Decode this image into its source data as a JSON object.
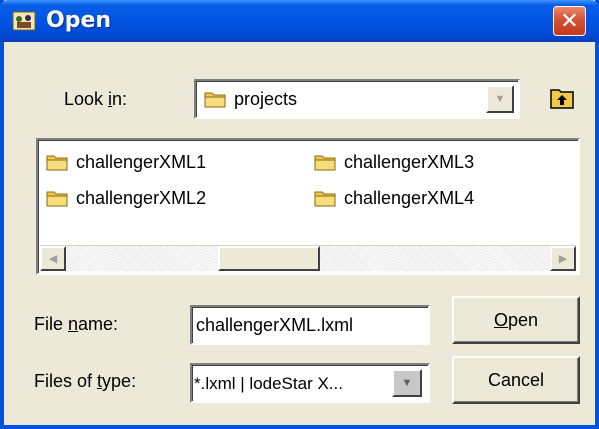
{
  "window": {
    "title": "Open"
  },
  "lookin": {
    "label_pre": "Look ",
    "label_u": "i",
    "label_post": "n:",
    "value": "projects"
  },
  "files": [
    {
      "name": "challengerXML1"
    },
    {
      "name": "challengerXML3"
    },
    {
      "name": "challengerXML2"
    },
    {
      "name": "challengerXML4"
    }
  ],
  "filename": {
    "label_pre": "File ",
    "label_u": "n",
    "label_post": "ame:",
    "value": "challengerXML.lxml"
  },
  "filetype": {
    "label_pre": "Files of ",
    "label_u": "t",
    "label_post": "ype:",
    "value": "*.lxml | lodeStar X..."
  },
  "buttons": {
    "open_u": "O",
    "open_rest": "pen",
    "cancel": "Cancel"
  },
  "colors": {
    "titlebar": "#0054e3",
    "close": "#d55233",
    "dialog_bg": "#ece9d8"
  },
  "icons": [
    "app-icon",
    "close-icon",
    "folder-icon",
    "up-one-level-icon",
    "dropdown-arrow-icon",
    "scroll-left-icon",
    "scroll-right-icon"
  ]
}
